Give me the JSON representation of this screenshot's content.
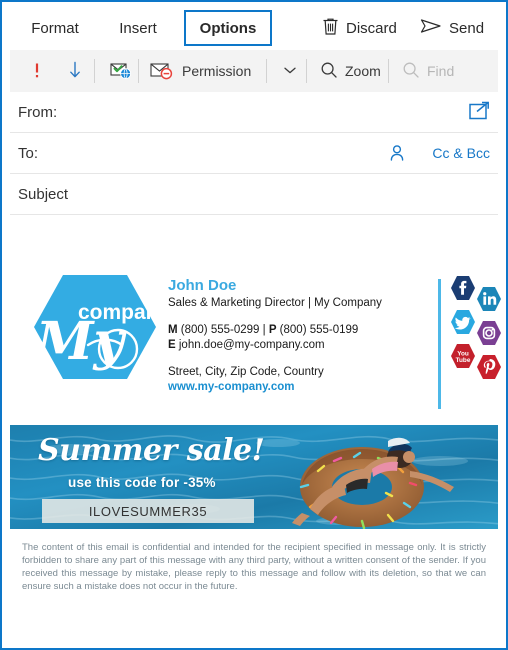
{
  "tabs": [
    {
      "label": "Format",
      "selected": false
    },
    {
      "label": "Insert",
      "selected": false
    },
    {
      "label": "Options",
      "selected": true
    }
  ],
  "commands": {
    "discard": "Discard",
    "send": "Send"
  },
  "ribbon": {
    "high_importance_icon": "exclamation-icon",
    "low_importance_icon": "down-arrow-icon",
    "tracking_icon": "delivery-receipt-icon",
    "permission_label": "Permission",
    "permission_icon": "envelope-block-icon",
    "chevron_icon": "chevron-down-icon",
    "zoom_label": "Zoom",
    "zoom_icon": "magnifier-icon",
    "find_label": "Find",
    "find_icon": "magnifier-icon",
    "find_disabled": true
  },
  "fields": {
    "from_label": "From:",
    "from_value": "",
    "to_label": "To:",
    "to_value": "",
    "subject_label": "Subject",
    "subject_value": "",
    "cc_bcc_label": "Cc & Bcc",
    "popout_icon": "pop-out-icon",
    "person_icon": "person-icon"
  },
  "signature": {
    "logo": {
      "word_script": "my",
      "word_plain": "company",
      "color": "#33ace3"
    },
    "name": "John Doe",
    "role": "Sales & Marketing Director | My Company",
    "phone_line_prefix_m": "M",
    "phone_line_m": " (800) 555-0299 | ",
    "phone_line_prefix_p": "P",
    "phone_line_p": " (800) 555-0199",
    "email_prefix": "E",
    "email": " john.doe@my-company.com",
    "address": "Street, City, Zip Code, Country",
    "website": "www.my-company.com",
    "name_color": "#3aa9e0",
    "link_color": "#1a8fd0",
    "socials": [
      {
        "name": "facebook-icon",
        "glyph": "f",
        "color": "#1b3d73"
      },
      {
        "name": "linkedin-icon",
        "glyph": "in",
        "color": "#1b86b8"
      },
      {
        "name": "twitter-icon",
        "glyph": "t",
        "color": "#29a8e0"
      },
      {
        "name": "instagram-icon",
        "glyph": "o",
        "color": "#7a3f93"
      },
      {
        "name": "youtube-icon",
        "glyph": "You Tube",
        "color": "#c3202b"
      },
      {
        "name": "pinterest-icon",
        "glyph": "P",
        "color": "#c8202c"
      }
    ]
  },
  "banner": {
    "title": "Summer sale!",
    "subtitle": "use this code for -35%",
    "promo_code": "ILOVESUMMER35",
    "image_alt": "woman floating on donut pool float in blue water"
  },
  "disclaimer": "The content of this email is confidential and intended for the recipient specified in message only. It is strictly forbidden to share any part of this message with any third party, without a written consent of the sender. If you received this message by mistake, please reply to this message and follow with its deletion, so that we can ensure such a mistake does not occur in the future."
}
